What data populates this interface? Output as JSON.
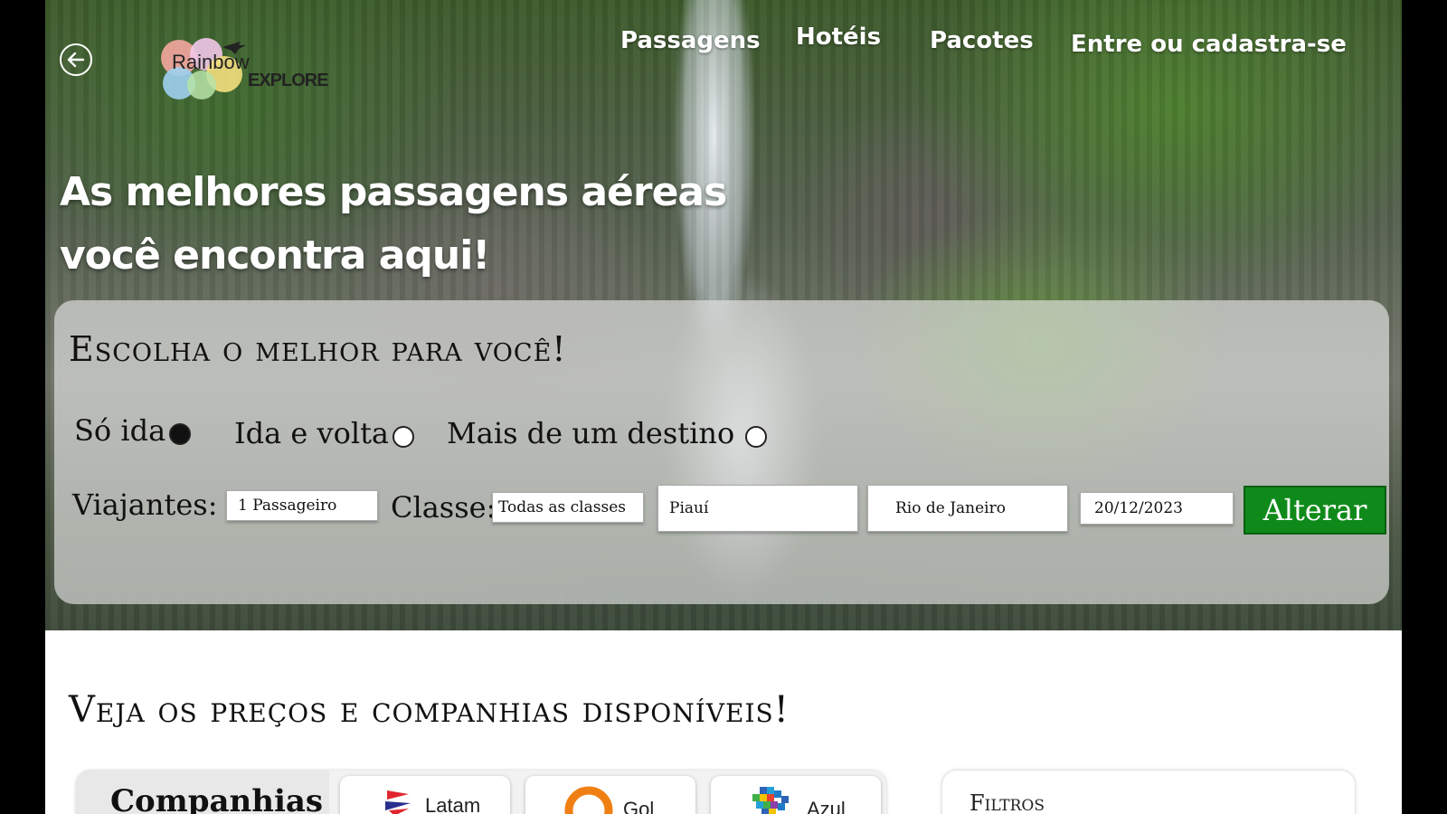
{
  "header": {
    "back_icon": "arrow-left-icon",
    "logo": {
      "line1": "Rainbow",
      "line2": "EXPLORE"
    },
    "nav": {
      "passagens": "Passagens",
      "hoteis": "Hotéis",
      "pacotes": "Pacotes",
      "login": "Entre ou cadastra-se"
    }
  },
  "hero": {
    "title_line1": "As melhores passagens aéreas",
    "title_line2": "você encontra aqui!"
  },
  "search": {
    "title": "Escolha o melhor para você!",
    "trip_types": [
      {
        "label": "Só ida",
        "selected": true
      },
      {
        "label": "Ida e volta",
        "selected": false
      },
      {
        "label": "Mais de um destino",
        "selected": false
      }
    ],
    "travelers_label": "Viajantes:",
    "travelers_value": "1 Passageiro",
    "class_label": "Classe:",
    "class_value": "Todas as classes",
    "origin": "Piauí",
    "destination": "Rio de Janeiro",
    "date": "20/12/2023",
    "submit_label": "Alterar",
    "submit_color": "#0f8a1a"
  },
  "results": {
    "title": "Veja os preços e companhias disponíveis!",
    "companies_label": "Companhias",
    "airlines": [
      {
        "name": "Latam"
      },
      {
        "name": "Gol"
      },
      {
        "name": "Azul"
      }
    ],
    "filters_label": "Filtros"
  }
}
